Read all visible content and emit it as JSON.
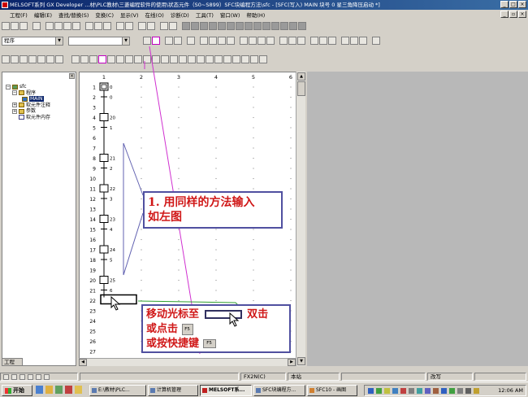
{
  "window": {
    "title": "MELSOFT系列 GX Developer ...材\\PLC教材\\三菱编程软件的使用\\状态元件（S0~S899）SFC块编程方法\\sfc - [SFC(写入)   MAIN   块号  0  星三角降压启动  *]"
  },
  "menu": {
    "items": [
      "工程(F)",
      "编辑(E)",
      "查找/替换(S)",
      "变换(C)",
      "显示(V)",
      "在线(O)",
      "诊断(D)",
      "工具(T)",
      "窗口(W)",
      "帮助(H)"
    ]
  },
  "toolbar": {
    "combo_program": "程序"
  },
  "project_tree": {
    "root": "sfc",
    "nodes": [
      {
        "label": "程序",
        "level": 1
      },
      {
        "label": "MAIN",
        "level": 2,
        "selected": true
      },
      {
        "label": "软元件注释",
        "level": 1
      },
      {
        "label": "参数",
        "level": 1
      },
      {
        "label": "软元件内存",
        "level": 1
      }
    ],
    "tab": "工程"
  },
  "sfc": {
    "col_numbers": [
      "1",
      "2",
      "3",
      "4",
      "5",
      "6"
    ],
    "row_numbers": [
      "1",
      "2",
      "3",
      "4",
      "5",
      "6",
      "7",
      "8",
      "9",
      "10",
      "11",
      "12",
      "13",
      "14",
      "15",
      "16",
      "17",
      "18",
      "19",
      "20",
      "21",
      "22",
      "23",
      "24",
      "25",
      "26",
      "27"
    ],
    "labels": {
      "1": "0",
      "2": "0",
      "4": "20",
      "5": "1",
      "8": "21",
      "9": "2",
      "11": "22",
      "12": "3",
      "14": "23",
      "15": "4",
      "17": "24",
      "18": "5",
      "20": "25",
      "21": "6"
    },
    "initial_step_row": 1,
    "step_rows": [
      4,
      8,
      11,
      14,
      17,
      20
    ],
    "transition_rows": [
      2,
      5,
      9,
      12,
      15,
      18,
      21
    ],
    "cursor_row": 22
  },
  "callouts": {
    "step1_line1": "1. 用同样的方法输入",
    "step1_line2": "如左图",
    "move_text": "移动光标至",
    "dbl_click": "双击",
    "or_click": "或点击",
    "or_shortcut": "或按快捷键",
    "key_f5": "F5",
    "key_icon": "F5"
  },
  "status": {
    "mode": "FX2N(C)",
    "rw": "本站",
    "ovr": "改写"
  },
  "taskbar": {
    "start": "开始",
    "tasks": [
      "E:\\教材\\PLC...",
      "计算机管理",
      "MELSOFT系...",
      "SFC块编程方...",
      "SFC10 - 画图"
    ],
    "clock": "12:06 AM"
  }
}
